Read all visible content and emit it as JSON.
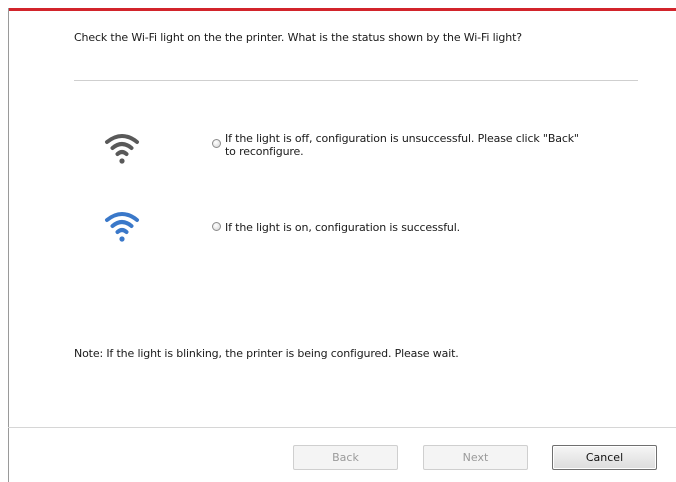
{
  "question": "Check the Wi-Fi light on the the printer. What is the status shown by the Wi-Fi light?",
  "options": [
    {
      "icon": "wifi-gray-icon",
      "color": "#595959",
      "text": "If the light is off, configuration is unsuccessful. Please click \"Back\" to reconfigure.",
      "selected": false
    },
    {
      "icon": "wifi-blue-icon",
      "color": "#3a78c9",
      "text": "If the light is on, configuration is successful.",
      "selected": false
    }
  ],
  "note": "Note:  If the light is blinking, the printer is being configured.  Please wait.",
  "buttons": {
    "back": "Back",
    "next": "Next",
    "cancel": "Cancel"
  },
  "colors": {
    "accent_bar": "#d2242b"
  }
}
